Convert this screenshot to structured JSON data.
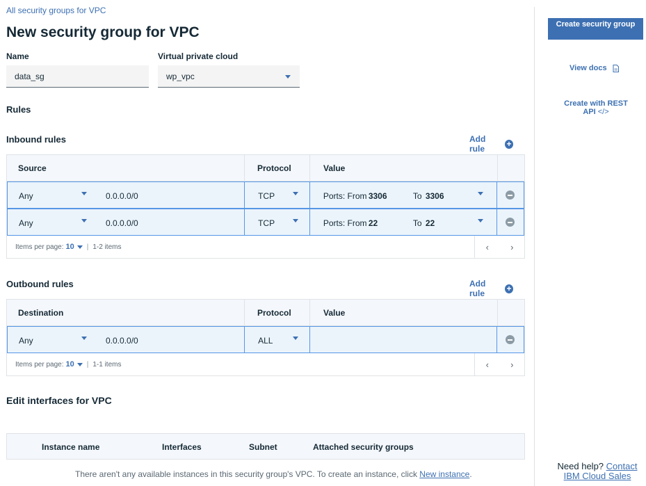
{
  "breadcrumb": "All security groups for VPC",
  "page_title": "New security group for VPC",
  "form": {
    "name_label": "Name",
    "name_value": "data_sg",
    "vpc_label": "Virtual private cloud",
    "vpc_value": "wp_vpc"
  },
  "rules_heading": "Rules",
  "inbound": {
    "heading": "Inbound rules",
    "add_rule": "Add rule",
    "columns": [
      "Source",
      "Protocol",
      "Value"
    ],
    "rows": [
      {
        "source": "Any",
        "cidr": "0.0.0.0/0",
        "protocol": "TCP",
        "ports_label": "Ports: From",
        "from": "3306",
        "to_label": "To",
        "to": "3306"
      },
      {
        "source": "Any",
        "cidr": "0.0.0.0/0",
        "protocol": "TCP",
        "ports_label": "Ports: From",
        "from": "22",
        "to_label": "To",
        "to": "22"
      }
    ],
    "items_per_page_label": "Items per page:",
    "items_per_page": "10",
    "items_range": "1-2 items"
  },
  "outbound": {
    "heading": "Outbound rules",
    "add_rule": "Add rule",
    "columns": [
      "Destination",
      "Protocol",
      "Value"
    ],
    "rows": [
      {
        "destination": "Any",
        "cidr": "0.0.0.0/0",
        "protocol": "ALL"
      }
    ],
    "items_per_page_label": "Items per page:",
    "items_per_page": "10",
    "items_range": "1-1 items"
  },
  "interfaces": {
    "heading": "Edit interfaces for VPC",
    "columns": [
      "Instance name",
      "Interfaces",
      "Subnet",
      "Attached security groups"
    ],
    "empty_text": "There aren't any available instances in this security group's VPC. To create an instance, click ",
    "empty_link": "New instance",
    "empty_end": "."
  },
  "sidebar": {
    "create_button": "Create security group",
    "view_docs": "View docs",
    "rest_api": "Create with REST API",
    "help_prefix": "Need help?",
    "help_link_1": "Contact",
    "help_link_2": "IBM Cloud Sales"
  },
  "colors": {
    "primary": "#3d70b2",
    "row_bg": "#ebf4fb",
    "row_border": "#5596e6"
  }
}
